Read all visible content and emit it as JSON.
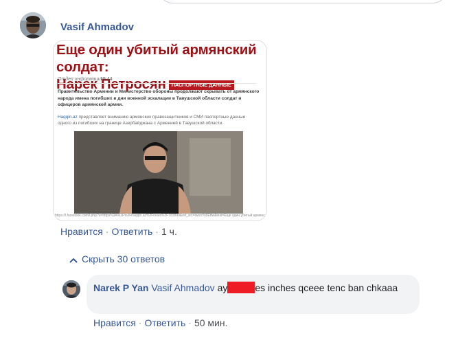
{
  "post": {
    "author": "Vasif Ahmadov",
    "article": {
      "headline_line1": "Еще один убитый армянский солдат:",
      "headline_line2": "Нарек Петросян",
      "badge": "ПАСПОРТНЫЕ ДАННЫЕ",
      "section": "Отдел информации",
      "time": "19:44",
      "lead": "Правительство Армении и Министерство обороны продолжают скрывать от армянского народа имена погибших в дни военной эскалации в Тавушской области солдат и офицеров армянской армии.",
      "body_source": "Haqqin.az",
      "body": " представляет вниманию армянских правозащитников и СМИ паспортные данные одного из погибших на границе Азербайджана с Арменией в Тавушской области.",
      "photo_url": "https://l.facebook.com/l.php?u=https%3A%2F%2Fhaqqin.az%2Fnews%2F183890&ref_src=twsrc%5Etfw&text=Еще один убитый армянский солдат%3A Нарек Петросян"
    },
    "actions": {
      "like": "Нравится",
      "reply": "Ответить",
      "time": "1 ч."
    },
    "toggle_replies": "Скрыть 30 ответов"
  },
  "reply": {
    "author": "Narek P Yan",
    "tagged": "Vasif Ahmadov",
    "text_before": "ay",
    "text_after": "es inches qceee tenc ban chkaaa",
    "actions": {
      "like": "Нравится",
      "reply": "Ответить",
      "time": "50 мин."
    }
  },
  "colors": {
    "link": "#385898",
    "bubble": "#f2f3f5",
    "redaction": "#ee1c24",
    "headline": "#9b1116"
  },
  "icons": {
    "toggle": "chevron-up-icon"
  }
}
